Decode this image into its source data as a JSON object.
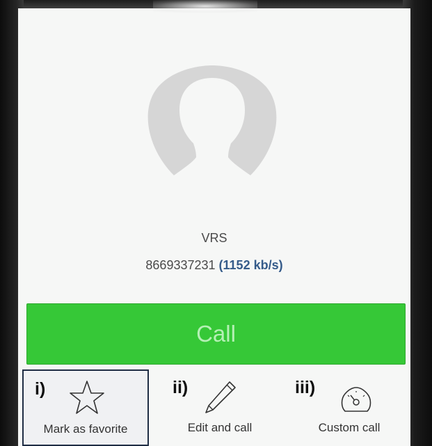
{
  "contact": {
    "name": "VRS",
    "number": "8669337231",
    "bitrate": "(1152 kb/s)"
  },
  "call_button": {
    "label": "Call"
  },
  "actions": [
    {
      "marker": "i)",
      "label": "Mark as favorite",
      "icon": "star-icon"
    },
    {
      "marker": "ii)",
      "label": "Edit and call",
      "icon": "pencil-icon"
    },
    {
      "marker": "iii)",
      "label": "Custom call",
      "icon": "gauge-icon"
    }
  ],
  "colors": {
    "call_green": "#36c837",
    "bitrate_blue": "#355b8a",
    "selected_border": "#1f2d44"
  }
}
